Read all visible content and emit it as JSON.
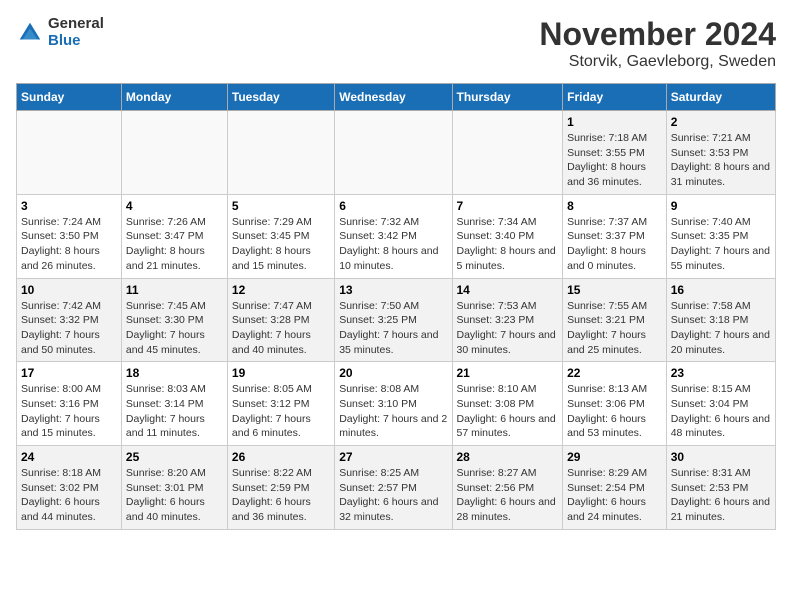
{
  "logo": {
    "general": "General",
    "blue": "Blue"
  },
  "title": "November 2024",
  "subtitle": "Storvik, Gaevleborg, Sweden",
  "days_of_week": [
    "Sunday",
    "Monday",
    "Tuesday",
    "Wednesday",
    "Thursday",
    "Friday",
    "Saturday"
  ],
  "weeks": [
    [
      {
        "day": "",
        "info": ""
      },
      {
        "day": "",
        "info": ""
      },
      {
        "day": "",
        "info": ""
      },
      {
        "day": "",
        "info": ""
      },
      {
        "day": "",
        "info": ""
      },
      {
        "day": "1",
        "info": "Sunrise: 7:18 AM\nSunset: 3:55 PM\nDaylight: 8 hours and 36 minutes."
      },
      {
        "day": "2",
        "info": "Sunrise: 7:21 AM\nSunset: 3:53 PM\nDaylight: 8 hours and 31 minutes."
      }
    ],
    [
      {
        "day": "3",
        "info": "Sunrise: 7:24 AM\nSunset: 3:50 PM\nDaylight: 8 hours and 26 minutes."
      },
      {
        "day": "4",
        "info": "Sunrise: 7:26 AM\nSunset: 3:47 PM\nDaylight: 8 hours and 21 minutes."
      },
      {
        "day": "5",
        "info": "Sunrise: 7:29 AM\nSunset: 3:45 PM\nDaylight: 8 hours and 15 minutes."
      },
      {
        "day": "6",
        "info": "Sunrise: 7:32 AM\nSunset: 3:42 PM\nDaylight: 8 hours and 10 minutes."
      },
      {
        "day": "7",
        "info": "Sunrise: 7:34 AM\nSunset: 3:40 PM\nDaylight: 8 hours and 5 minutes."
      },
      {
        "day": "8",
        "info": "Sunrise: 7:37 AM\nSunset: 3:37 PM\nDaylight: 8 hours and 0 minutes."
      },
      {
        "day": "9",
        "info": "Sunrise: 7:40 AM\nSunset: 3:35 PM\nDaylight: 7 hours and 55 minutes."
      }
    ],
    [
      {
        "day": "10",
        "info": "Sunrise: 7:42 AM\nSunset: 3:32 PM\nDaylight: 7 hours and 50 minutes."
      },
      {
        "day": "11",
        "info": "Sunrise: 7:45 AM\nSunset: 3:30 PM\nDaylight: 7 hours and 45 minutes."
      },
      {
        "day": "12",
        "info": "Sunrise: 7:47 AM\nSunset: 3:28 PM\nDaylight: 7 hours and 40 minutes."
      },
      {
        "day": "13",
        "info": "Sunrise: 7:50 AM\nSunset: 3:25 PM\nDaylight: 7 hours and 35 minutes."
      },
      {
        "day": "14",
        "info": "Sunrise: 7:53 AM\nSunset: 3:23 PM\nDaylight: 7 hours and 30 minutes."
      },
      {
        "day": "15",
        "info": "Sunrise: 7:55 AM\nSunset: 3:21 PM\nDaylight: 7 hours and 25 minutes."
      },
      {
        "day": "16",
        "info": "Sunrise: 7:58 AM\nSunset: 3:18 PM\nDaylight: 7 hours and 20 minutes."
      }
    ],
    [
      {
        "day": "17",
        "info": "Sunrise: 8:00 AM\nSunset: 3:16 PM\nDaylight: 7 hours and 15 minutes."
      },
      {
        "day": "18",
        "info": "Sunrise: 8:03 AM\nSunset: 3:14 PM\nDaylight: 7 hours and 11 minutes."
      },
      {
        "day": "19",
        "info": "Sunrise: 8:05 AM\nSunset: 3:12 PM\nDaylight: 7 hours and 6 minutes."
      },
      {
        "day": "20",
        "info": "Sunrise: 8:08 AM\nSunset: 3:10 PM\nDaylight: 7 hours and 2 minutes."
      },
      {
        "day": "21",
        "info": "Sunrise: 8:10 AM\nSunset: 3:08 PM\nDaylight: 6 hours and 57 minutes."
      },
      {
        "day": "22",
        "info": "Sunrise: 8:13 AM\nSunset: 3:06 PM\nDaylight: 6 hours and 53 minutes."
      },
      {
        "day": "23",
        "info": "Sunrise: 8:15 AM\nSunset: 3:04 PM\nDaylight: 6 hours and 48 minutes."
      }
    ],
    [
      {
        "day": "24",
        "info": "Sunrise: 8:18 AM\nSunset: 3:02 PM\nDaylight: 6 hours and 44 minutes."
      },
      {
        "day": "25",
        "info": "Sunrise: 8:20 AM\nSunset: 3:01 PM\nDaylight: 6 hours and 40 minutes."
      },
      {
        "day": "26",
        "info": "Sunrise: 8:22 AM\nSunset: 2:59 PM\nDaylight: 6 hours and 36 minutes."
      },
      {
        "day": "27",
        "info": "Sunrise: 8:25 AM\nSunset: 2:57 PM\nDaylight: 6 hours and 32 minutes."
      },
      {
        "day": "28",
        "info": "Sunrise: 8:27 AM\nSunset: 2:56 PM\nDaylight: 6 hours and 28 minutes."
      },
      {
        "day": "29",
        "info": "Sunrise: 8:29 AM\nSunset: 2:54 PM\nDaylight: 6 hours and 24 minutes."
      },
      {
        "day": "30",
        "info": "Sunrise: 8:31 AM\nSunset: 2:53 PM\nDaylight: 6 hours and 21 minutes."
      }
    ]
  ]
}
